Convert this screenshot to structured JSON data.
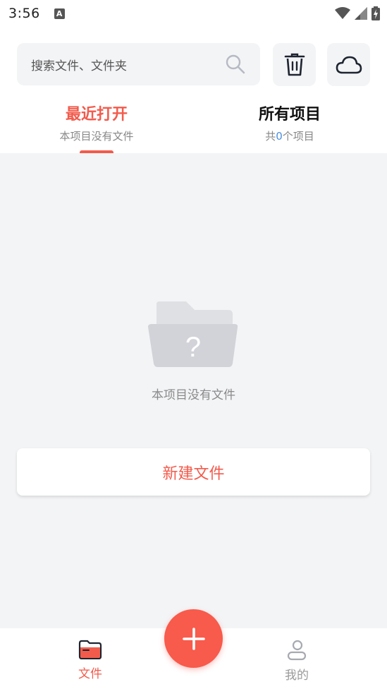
{
  "status_bar": {
    "time": "3:56",
    "notification_letter": "A",
    "icons": [
      "wifi-icon",
      "signal-icon",
      "battery-charging-icon"
    ]
  },
  "search": {
    "placeholder": "搜索文件、文件夹",
    "icon": "search-icon"
  },
  "toolbar": {
    "trash_icon": "trash-icon",
    "cloud_icon": "cloud-icon"
  },
  "tabs": [
    {
      "title": "最近打开",
      "subtitle": "本项目没有文件",
      "active": true
    },
    {
      "title": "所有项目",
      "subtitle_prefix": "共",
      "count": "0",
      "subtitle_suffix": "个项目",
      "active": false
    }
  ],
  "empty_state": {
    "icon": "empty-folder-question-icon",
    "message": "本项目没有文件"
  },
  "new_file_button": {
    "label": "新建文件"
  },
  "fab": {
    "icon": "plus-icon"
  },
  "bottom_nav": [
    {
      "label": "文件",
      "icon": "folder-icon",
      "active": true
    },
    {
      "label": "我的",
      "icon": "user-icon",
      "active": false
    }
  ],
  "colors": {
    "accent": "#f25b4c",
    "fab": "#f85a4b",
    "background": "#f3f4f6",
    "count_blue": "#4a8fe0"
  }
}
